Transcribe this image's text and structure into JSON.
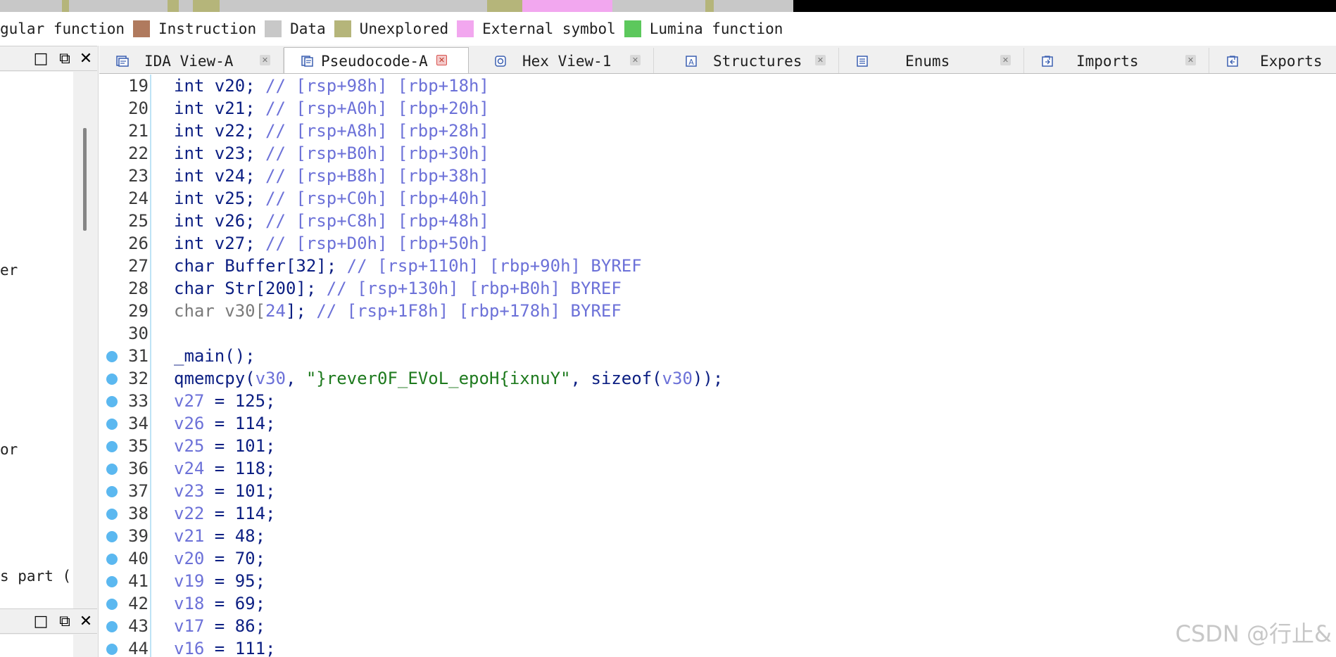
{
  "legend": {
    "items": [
      {
        "label": "gular function",
        "color": null
      },
      {
        "label": "Instruction",
        "color": "#b07a5e"
      },
      {
        "label": "Data",
        "color": "#c8c8c8"
      },
      {
        "label": "Unexplored",
        "color": "#b5b57a"
      },
      {
        "label": "External symbol",
        "color": "#f2a7ef"
      },
      {
        "label": "Lumina function",
        "color": "#5cc85c"
      }
    ]
  },
  "left_panel": {
    "fragments": [
      "er",
      "or",
      "s part ("
    ],
    "buttons": {
      "maximize": "□",
      "restore": "⧉",
      "close": "✕"
    }
  },
  "tabs": [
    {
      "label": "IDA View-A",
      "icon": "ida-view-icon",
      "active": false
    },
    {
      "label": "Pseudocode-A",
      "icon": "pseudocode-icon",
      "active": true
    },
    {
      "label": "Hex View-1",
      "icon": "hex-view-icon",
      "active": false
    },
    {
      "label": "Structures",
      "icon": "structures-icon",
      "active": false
    },
    {
      "label": "Enums",
      "icon": "enums-icon",
      "active": false
    },
    {
      "label": "Imports",
      "icon": "imports-icon",
      "active": false
    },
    {
      "label": "Exports",
      "icon": "exports-icon",
      "active": false
    }
  ],
  "code": {
    "lines": [
      {
        "n": "19",
        "bp": false,
        "type": "decl",
        "ty": "int",
        "name": "v20",
        "rsp": "rsp+98h",
        "rbp": "rbp+18h"
      },
      {
        "n": "20",
        "bp": false,
        "type": "decl",
        "ty": "int",
        "name": "v21",
        "rsp": "rsp+A0h",
        "rbp": "rbp+20h"
      },
      {
        "n": "21",
        "bp": false,
        "type": "decl",
        "ty": "int",
        "name": "v22",
        "rsp": "rsp+A8h",
        "rbp": "rbp+28h"
      },
      {
        "n": "22",
        "bp": false,
        "type": "decl",
        "ty": "int",
        "name": "v23",
        "rsp": "rsp+B0h",
        "rbp": "rbp+30h"
      },
      {
        "n": "23",
        "bp": false,
        "type": "decl",
        "ty": "int",
        "name": "v24",
        "rsp": "rsp+B8h",
        "rbp": "rbp+38h"
      },
      {
        "n": "24",
        "bp": false,
        "type": "decl",
        "ty": "int",
        "name": "v25",
        "rsp": "rsp+C0h",
        "rbp": "rbp+40h"
      },
      {
        "n": "25",
        "bp": false,
        "type": "decl",
        "ty": "int",
        "name": "v26",
        "rsp": "rsp+C8h",
        "rbp": "rbp+48h"
      },
      {
        "n": "26",
        "bp": false,
        "type": "decl",
        "ty": "int",
        "name": "v27",
        "rsp": "rsp+D0h",
        "rbp": "rbp+50h"
      },
      {
        "n": "27",
        "bp": false,
        "type": "arr",
        "ty": "char",
        "name": "Buffer",
        "size": "32",
        "rsp": "rsp+110h",
        "rbp": "rbp+90h",
        "suffix": "BYREF"
      },
      {
        "n": "28",
        "bp": false,
        "type": "arr",
        "ty": "char",
        "name": "Str",
        "size": "200",
        "rsp": "rsp+130h",
        "rbp": "rbp+B0h",
        "suffix": "BYREF"
      },
      {
        "n": "29",
        "bp": false,
        "type": "arrgray",
        "ty": "char",
        "name": "v30",
        "size": "24",
        "rsp": "rsp+1F8h",
        "rbp": "rbp+178h",
        "suffix": "BYREF"
      },
      {
        "n": "30",
        "bp": false,
        "type": "blank"
      },
      {
        "n": "31",
        "bp": true,
        "type": "call",
        "text": "_main();"
      },
      {
        "n": "32",
        "bp": true,
        "type": "memcpy",
        "fn": "qmemcpy",
        "arg1": "v30",
        "str": "\"}rever0F_EVoL_epoH{ixnuY\"",
        "sz": "sizeof",
        "arg3": "v30"
      },
      {
        "n": "33",
        "bp": true,
        "type": "assign",
        "name": "v27",
        "value": "125"
      },
      {
        "n": "34",
        "bp": true,
        "type": "assign",
        "name": "v26",
        "value": "114"
      },
      {
        "n": "35",
        "bp": true,
        "type": "assign",
        "name": "v25",
        "value": "101"
      },
      {
        "n": "36",
        "bp": true,
        "type": "assign",
        "name": "v24",
        "value": "118"
      },
      {
        "n": "37",
        "bp": true,
        "type": "assign",
        "name": "v23",
        "value": "101"
      },
      {
        "n": "38",
        "bp": true,
        "type": "assign",
        "name": "v22",
        "value": "114"
      },
      {
        "n": "39",
        "bp": true,
        "type": "assign",
        "name": "v21",
        "value": "48"
      },
      {
        "n": "40",
        "bp": true,
        "type": "assign",
        "name": "v20",
        "value": "70"
      },
      {
        "n": "41",
        "bp": true,
        "type": "assign",
        "name": "v19",
        "value": "95"
      },
      {
        "n": "42",
        "bp": true,
        "type": "assign",
        "name": "v18",
        "value": "69"
      },
      {
        "n": "43",
        "bp": true,
        "type": "assign",
        "name": "v17",
        "value": "86"
      },
      {
        "n": "44",
        "bp": true,
        "type": "assign",
        "name": "v16",
        "value": "111"
      }
    ]
  },
  "watermark": "CSDN @行止&"
}
